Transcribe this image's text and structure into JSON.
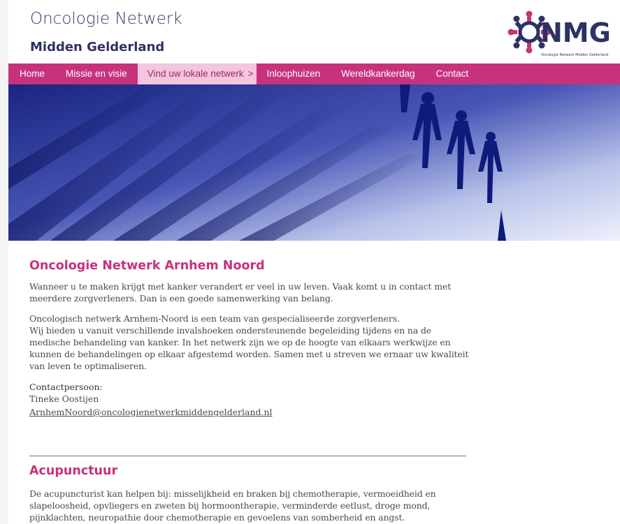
{
  "header": {
    "title": "Oncologie Netwerk",
    "subtitle": "Midden Gelderland",
    "logo": {
      "text": "ONMG",
      "caption": "Oncologie Netwerk Midden Gelderland",
      "colors": {
        "navy": "#2d3163",
        "pink": "#c7327c"
      }
    }
  },
  "nav": {
    "items": [
      {
        "label": "Home"
      },
      {
        "label": "Missie en visie"
      },
      {
        "label": "Vind uw lokale netwerk",
        "suffix": ">",
        "active": true
      },
      {
        "label": "Inloophuizen"
      },
      {
        "label": "Wereldkankerdag"
      },
      {
        "label": "Contact"
      }
    ]
  },
  "article": {
    "heading": "Oncologie Netwerk Arnhem Noord",
    "paragraph1": "Wanneer u te maken krijgt met kanker verandert er veel in uw leven. Vaak komt u in contact met meerdere zorgverleners. Dan is een goede samenwerking van belang.",
    "paragraph2_line1": "Oncologisch netwerk Arnhem-Noord is een team van gespecialiseerde zorgverleners.",
    "paragraph2_rest": "Wij bieden u vanuit verschillende invalshoeken ondersteunende begeleiding tijdens en na de medische behandeling van kanker. In het netwerk zijn we op de hoogte van elkaars werkwijze en kunnen de behandelingen op elkaar afgestemd worden. Samen met u streven we ernaar uw kwaliteit van leven te optimaliseren.",
    "contact_label": "Contactpersoon:",
    "contact_name": "Tineke Oostijen",
    "contact_email": "ArnhemNoord@oncologienetwerkmiddengelderland.nl"
  },
  "section2": {
    "heading": "Acupunctuur",
    "paragraph": "De acupuncturist kan helpen bij: misselijkheid en braken bij chemotherapie, vermoeidheid en slapeloosheid, opvliegers en zweten bij hormoontherapie, verminderde eetlust, droge mond, pijnklachten, neuropathie door chemotherapie en gevoelens van somberheid en angst."
  },
  "colors": {
    "brand_pink": "#c7327c",
    "brand_navy": "#2d3163",
    "active_tab_bg": "#f3c6dd",
    "banner_blue": "#23309a"
  }
}
